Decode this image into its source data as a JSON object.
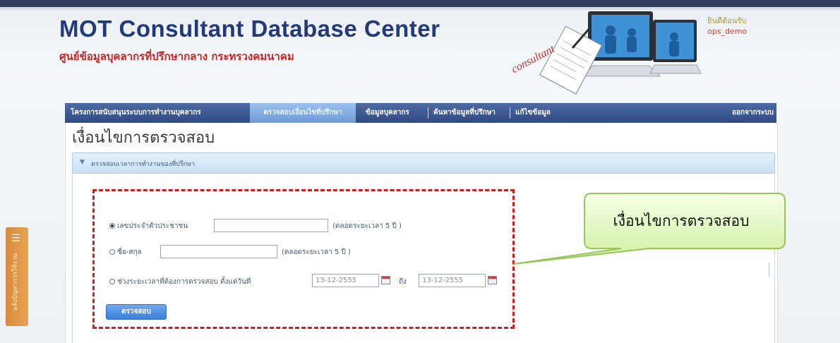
{
  "header": {
    "title": "MOT Consultant Database Center",
    "subtitle": "ศูนย์ข้อมูลบุคลากรที่ปรึกษากลาง กระทรวงคมนาคม",
    "welcome": "ยินดีต้อนรับ",
    "username": "ops_demo"
  },
  "illustration": {
    "script_text": "consultant"
  },
  "nav": {
    "items": [
      {
        "label": "โครงการสนับสนุนระบบการทำงานบุคลากร"
      },
      {
        "label": "ตรวจสอบเงื่อนไขที่ปรึกษา"
      },
      {
        "label": "ข้อมูลบุคลากร"
      },
      {
        "label": "ค้นหาข้อมูลที่ปรึกษา"
      },
      {
        "label": "แก้ไขข้อมูล"
      },
      {
        "label": "ออกจากระบบ"
      }
    ]
  },
  "main": {
    "page_title": "เงื่อนไขการตรวจสอบ",
    "accordion_title": "ตรวจสอบเวลาการทำงานของที่ปรึกษา",
    "options": {
      "id_label": "เลขประจำตัวประชาชน",
      "id_hint": "(ตลอดระยะเวลา 5 ปี )",
      "name_label": "ชื่อ-สกุล",
      "name_hint": "(ตลอดระยะเวลา 5 ปี )",
      "range_label": "ช่วงระยะเวลาที่ต้องการตรวจสอบ ตั้งแต่วันที่",
      "date_from": "13-12-2555",
      "to_label": "ถึง",
      "date_to": "13-12-2555"
    },
    "check_button": "ตรวจสอบ"
  },
  "callout": {
    "text": "เงื่อนไขการตรวจสอบ"
  },
  "side_tab": {
    "label": "แจ้งปัญหาการใช้งาน"
  },
  "colors": {
    "nav_bg": "#2f4a83",
    "nav_active": "#7ea8de",
    "title_blue": "#233a7a",
    "subtitle_red": "#cc2222",
    "dashed_red": "#cc1f1f",
    "callout_green": "#a9d86a",
    "button_blue": "#3a7fd8"
  },
  "icons": [
    "calendar-icon",
    "triangle-right-icon",
    "feedback-icon"
  ]
}
